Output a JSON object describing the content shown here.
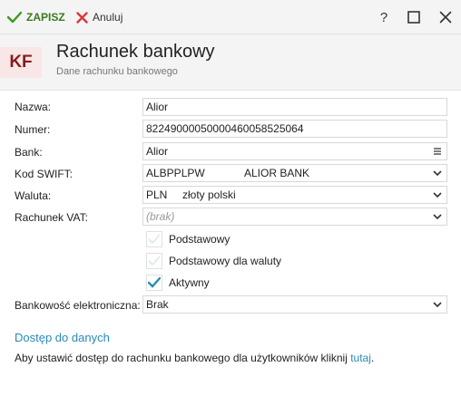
{
  "toolbar": {
    "save_label": "ZAPISZ",
    "cancel_label": "Anuluj",
    "help_label": "?"
  },
  "header": {
    "badge": "KF",
    "title": "Rachunek bankowy",
    "subtitle": "Dane rachunku bankowego"
  },
  "form": {
    "name_label": "Nazwa:",
    "name_value": "Alior",
    "number_label": "Numer:",
    "number_value": "82249000050000460058525064",
    "bank_label": "Bank:",
    "bank_value": "Alior",
    "swift_label": "Kod SWIFT:",
    "swift_code": "ALBPPLPW",
    "swift_bank": "ALIOR BANK",
    "currency_label": "Waluta:",
    "currency_code": "PLN",
    "currency_name": "złoty polski",
    "vat_label": "Rachunek VAT:",
    "vat_placeholder": "(brak)",
    "checkboxes": [
      {
        "label": "Podstawowy",
        "checked": false
      },
      {
        "label": "Podstawowy dla waluty",
        "checked": false
      },
      {
        "label": "Aktywny",
        "checked": true
      }
    ],
    "ebanking_label": "Bankowość elektroniczna:",
    "ebanking_value": "Brak"
  },
  "access": {
    "heading": "Dostęp do danych",
    "text": "Aby ustawić dostęp do rachunku bankowego dla użytkowników kliknij ",
    "link": "tutaj",
    "suffix": "."
  },
  "colors": {
    "accent": "#2a8ab8",
    "save_green": "#3a7a1d",
    "cancel_red": "#d43a3a",
    "badge_bg": "#f9e6e6",
    "badge_text": "#8b1a1a"
  }
}
